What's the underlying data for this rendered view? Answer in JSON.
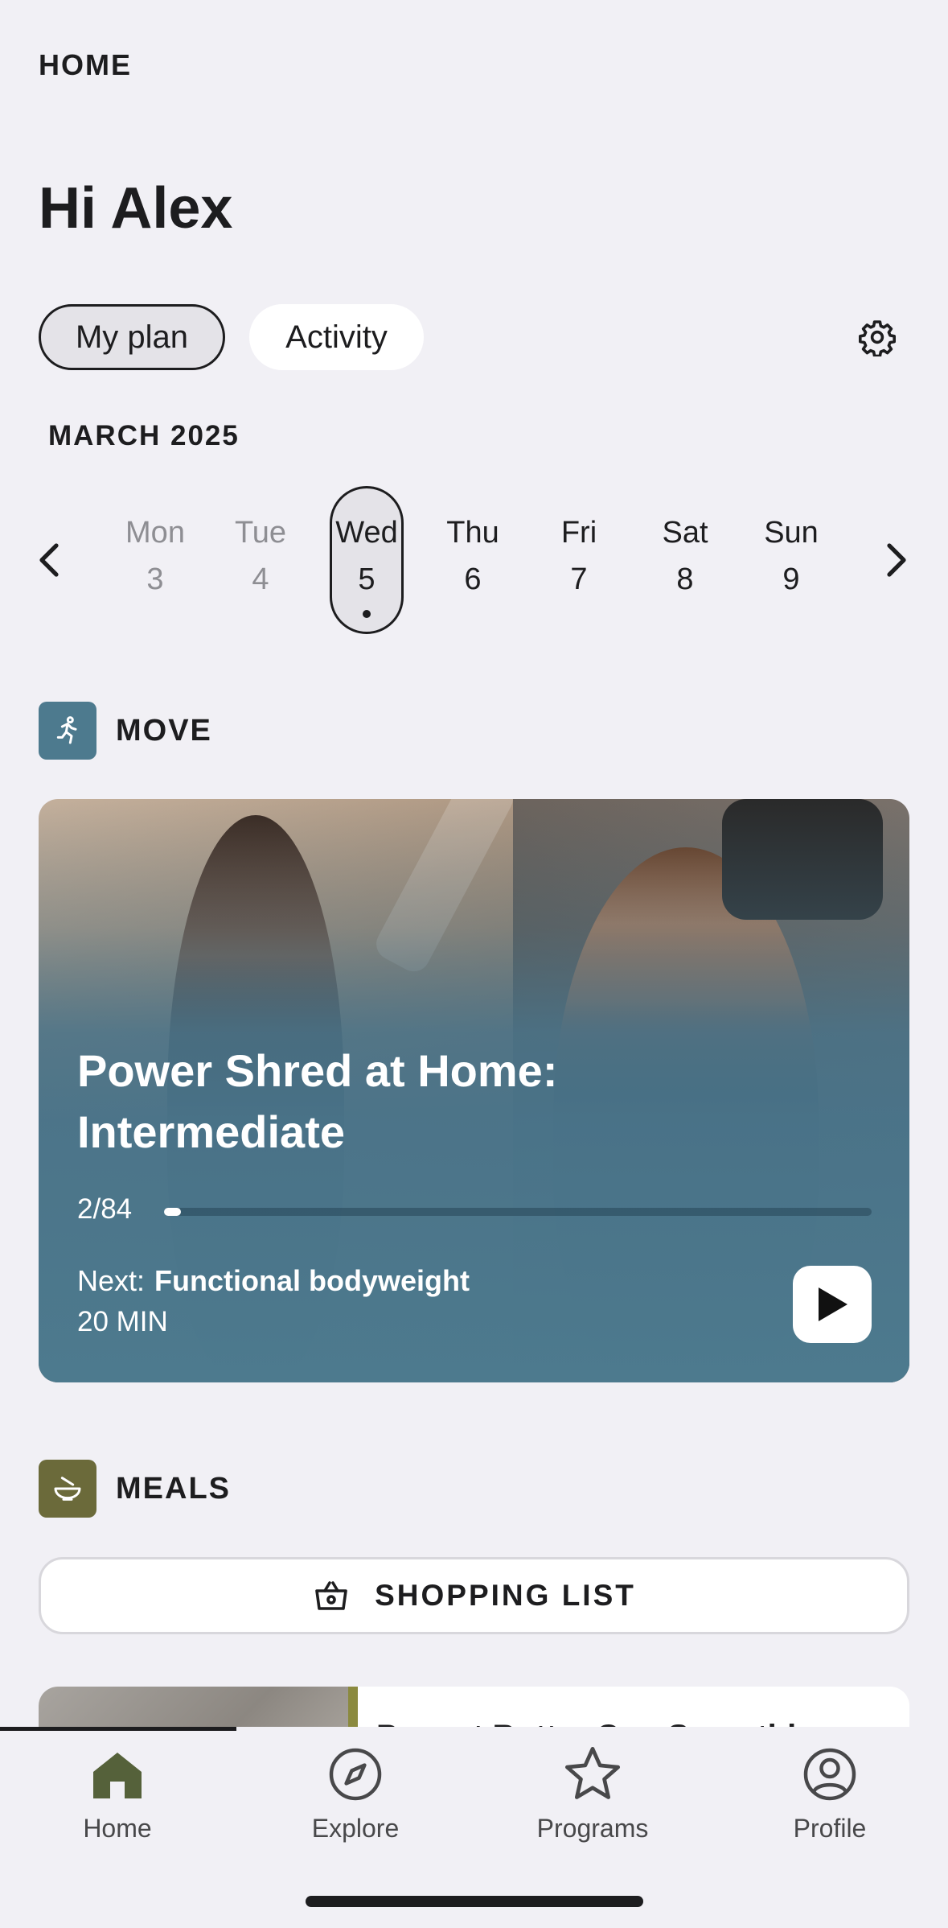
{
  "header": {
    "top_label": "HOME",
    "greeting": "Hi Alex"
  },
  "toggle": {
    "plan_label": "My plan",
    "activity_label": "Activity"
  },
  "calendar": {
    "month": "MARCH 2025",
    "days": [
      {
        "name": "Mon",
        "num": "3"
      },
      {
        "name": "Tue",
        "num": "4"
      },
      {
        "name": "Wed",
        "num": "5"
      },
      {
        "name": "Thu",
        "num": "6"
      },
      {
        "name": "Fri",
        "num": "7"
      },
      {
        "name": "Sat",
        "num": "8"
      },
      {
        "name": "Sun",
        "num": "9"
      }
    ],
    "selected_day": "Wed"
  },
  "move": {
    "section_title": "MOVE",
    "card": {
      "title_line1": "Power Shred at Home:",
      "title_line2": "Intermediate",
      "progress_text": "2/84",
      "progress_fraction": 0.024,
      "next_label": "Next:",
      "next_workout": "Functional bodyweight",
      "duration": "20 MIN"
    }
  },
  "meals": {
    "section_title": "MEALS",
    "shopping_label": "SHOPPING LIST",
    "meal_title": "Peanut Butter Cup Smoothie..."
  },
  "tabs": [
    {
      "label": "Home",
      "icon": "home-icon"
    },
    {
      "label": "Explore",
      "icon": "compass-icon"
    },
    {
      "label": "Programs",
      "icon": "star-icon"
    },
    {
      "label": "Profile",
      "icon": "profile-icon"
    }
  ],
  "colors": {
    "background": "#f1f0f5",
    "move_accent": "#4d7a8e",
    "meals_accent": "#6b6a3a",
    "active_tab": "#55613a"
  }
}
